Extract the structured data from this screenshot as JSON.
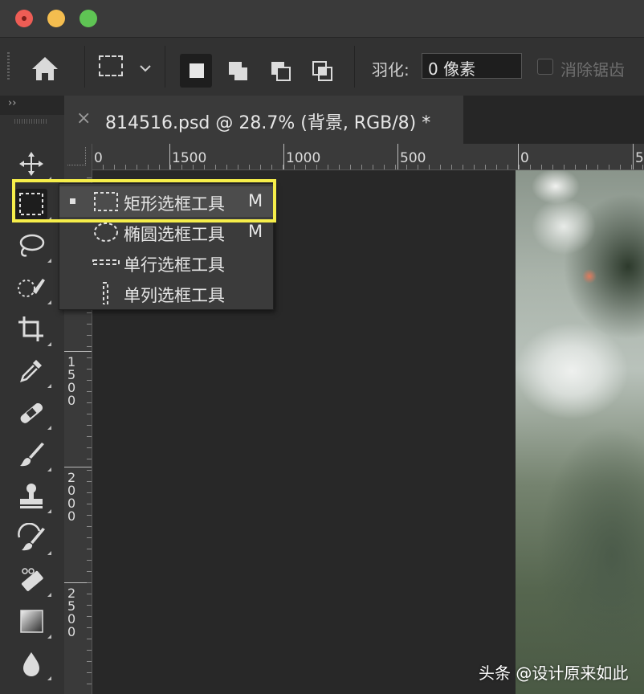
{
  "window": {
    "traffic_lights": [
      "close",
      "minimize",
      "zoom"
    ]
  },
  "options_bar": {
    "feather_label": "羽化:",
    "feather_value": "0 像素",
    "anti_alias_label": "消除锯齿",
    "anti_alias_checked": false,
    "selection_modes": [
      "new-selection",
      "add-to-selection",
      "subtract-from-selection",
      "intersect-with-selection"
    ],
    "active_mode": "new-selection"
  },
  "toolbar": {
    "collapse_glyph": "››",
    "tools": [
      "move",
      "rectangular-marquee",
      "lasso",
      "quick-selection",
      "crop",
      "eyedropper",
      "healing-brush",
      "brush",
      "clone-stamp",
      "history-brush",
      "eraser",
      "gradient",
      "blur"
    ],
    "selected_tool": "rectangular-marquee"
  },
  "document_tab": {
    "close_glyph": "×",
    "title": "814516.psd @ 28.7% (背景, RGB/8) *"
  },
  "rulers": {
    "horizontal_labels": [
      "0",
      "1500",
      "1000",
      "500",
      "0",
      "5"
    ],
    "vertical_labels": [
      "1500",
      "2000",
      "2500"
    ]
  },
  "flyout": {
    "items": [
      {
        "label": "矩形选框工具",
        "shortcut": "M",
        "active": true,
        "icon": "rect-marquee-icon"
      },
      {
        "label": "椭圆选框工具",
        "shortcut": "M",
        "active": false,
        "icon": "ellipse-marquee-icon"
      },
      {
        "label": "单行选框工具",
        "shortcut": "",
        "active": false,
        "icon": "single-row-marquee-icon"
      },
      {
        "label": "单列选框工具",
        "shortcut": "",
        "active": false,
        "icon": "single-column-marquee-icon"
      }
    ],
    "highlight_color": "#f6ee4a"
  },
  "watermark": "头条 @设计原来如此",
  "colors": {
    "ui_dark": "#323232",
    "canvas_bg": "#282828",
    "highlight": "#f6ee4a"
  }
}
